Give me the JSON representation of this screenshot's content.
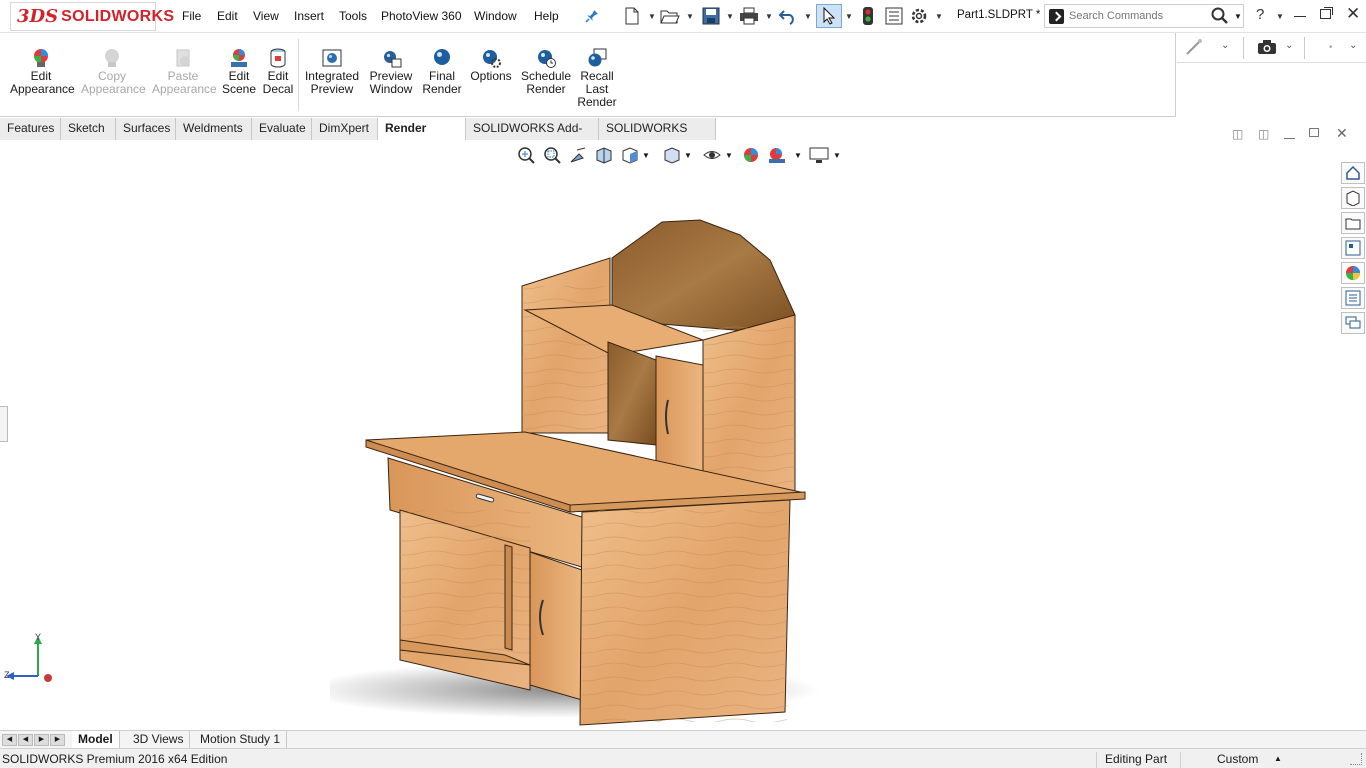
{
  "app": {
    "brand": "SOLIDWORKS",
    "brand_prefix": "3DS",
    "document_title": "Part1.SLDPRT *"
  },
  "menu": [
    {
      "label": "File"
    },
    {
      "label": "Edit"
    },
    {
      "label": "View"
    },
    {
      "label": "Insert"
    },
    {
      "label": "Tools"
    },
    {
      "label": "PhotoView 360"
    },
    {
      "label": "Window"
    },
    {
      "label": "Help"
    }
  ],
  "search": {
    "placeholder": "Search Commands",
    "value": ""
  },
  "ribbon": {
    "buttons": [
      {
        "label": "Edit Appearance",
        "line1": "Edit",
        "line2": "Appearance",
        "enabled": true
      },
      {
        "label": "Copy Appearance",
        "line1": "Copy",
        "line2": "Appearance",
        "enabled": false
      },
      {
        "label": "Paste Appearance",
        "line1": "Paste",
        "line2": "Appearance",
        "enabled": false
      },
      {
        "label": "Edit Scene",
        "line1": "Edit",
        "line2": "Scene",
        "enabled": true
      },
      {
        "label": "Edit Decal",
        "line1": "Edit",
        "line2": "Decal",
        "enabled": true
      },
      {
        "label": "Integrated Preview",
        "line1": "Integrated",
        "line2": "Preview",
        "enabled": true
      },
      {
        "label": "Preview Window",
        "line1": "Preview",
        "line2": "Window",
        "enabled": true
      },
      {
        "label": "Final Render",
        "line1": "Final",
        "line2": "Render",
        "enabled": true
      },
      {
        "label": "Options",
        "line1": "Options",
        "line2": "",
        "enabled": true
      },
      {
        "label": "Schedule Render",
        "line1": "Schedule",
        "line2": "Render",
        "enabled": true
      },
      {
        "label": "Recall Last Render",
        "line1": "Recall",
        "line2": "Last",
        "line3": "Render",
        "enabled": true
      }
    ]
  },
  "command_tabs": [
    {
      "label": "Features"
    },
    {
      "label": "Sketch"
    },
    {
      "label": "Surfaces"
    },
    {
      "label": "Weldments"
    },
    {
      "label": "Evaluate"
    },
    {
      "label": "DimXpert"
    },
    {
      "label": "Render Tools",
      "active": true
    },
    {
      "label": "SOLIDWORKS Add-Ins"
    },
    {
      "label": "SOLIDWORKS MBD"
    }
  ],
  "triad": {
    "y_label": "Y",
    "z_label": "Z"
  },
  "bottom_tabs": [
    {
      "label": "Model",
      "active": true
    },
    {
      "label": "3D Views"
    },
    {
      "label": "Motion Study 1"
    }
  ],
  "status": {
    "edition": "SOLIDWORKS Premium 2016 x64 Edition",
    "mode": "Editing Part",
    "units": "Custom"
  },
  "colors": {
    "brand_red": "#d3222a",
    "wood_light": "#e8b07a",
    "wood_mid": "#d99a5e",
    "wood_dark": "#8a5a2e"
  }
}
